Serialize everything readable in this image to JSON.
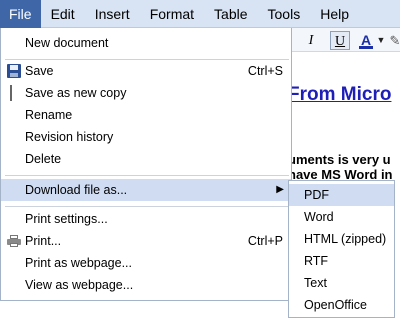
{
  "menubar": {
    "items": [
      "File",
      "Edit",
      "Insert",
      "Format",
      "Table",
      "Tools",
      "Help"
    ]
  },
  "toolbar": {
    "italic": "I",
    "underline": "U",
    "text_color": "A"
  },
  "document": {
    "heading": "From Micro",
    "line1": "uments is very u",
    "line2": "have MS Word in"
  },
  "file_menu": {
    "new_document": "New document",
    "save": "Save",
    "save_shortcut": "Ctrl+S",
    "save_as_new_copy": "Save as new copy",
    "rename": "Rename",
    "revision_history": "Revision history",
    "delete": "Delete",
    "download_file_as": "Download file as...",
    "print_settings": "Print settings...",
    "print": "Print...",
    "print_shortcut": "Ctrl+P",
    "print_as_webpage": "Print as webpage...",
    "view_as_webpage": "View as webpage..."
  },
  "download_submenu": {
    "items": [
      "PDF",
      "Word",
      "HTML (zipped)",
      "RTF",
      "Text",
      "OpenOffice"
    ]
  },
  "colors": {
    "menubar_bg": "#d8e4f3",
    "active_menu_bg": "#3f67a8",
    "highlight_row": "#cfdcf2",
    "heading_link": "#1f1fb8"
  }
}
